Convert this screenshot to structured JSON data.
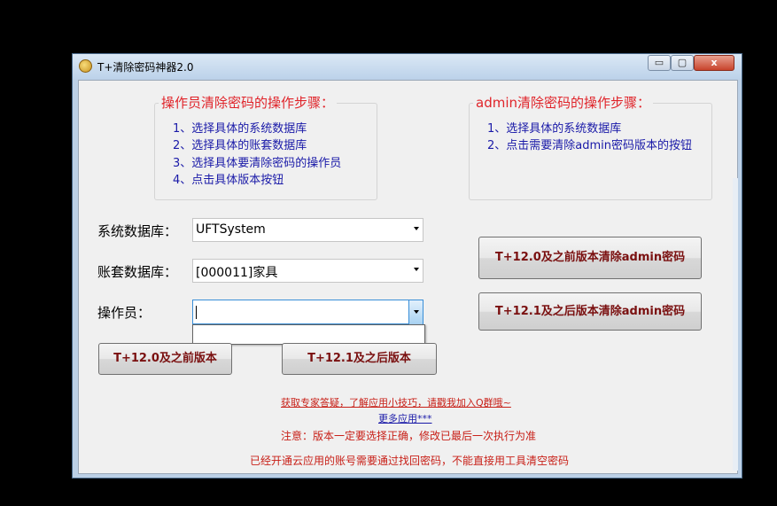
{
  "window": {
    "title": "T+清除密码神器2.0",
    "controls": {
      "minimize": "▭",
      "maximize": "▢",
      "close": "x"
    }
  },
  "operator_steps": {
    "title": "操作员清除密码的操作步骤：",
    "items": [
      "1、选择具体的系统数据库",
      "2、选择具体的账套数据库",
      "3、选择具体要清除密码的操作员",
      "4、点击具体版本按钮"
    ]
  },
  "admin_steps": {
    "title": "admin清除密码的操作步骤：",
    "items": [
      "1、选择具体的系统数据库",
      "2、点击需要清除admin密码版本的按钮"
    ]
  },
  "form": {
    "system_db_label": "系统数据库：",
    "system_db_value": "UFTSystem",
    "account_db_label": "账套数据库：",
    "account_db_value": "[000011]家具",
    "operator_label": "操作员：",
    "operator_value": ""
  },
  "buttons": {
    "v120_before": "T+12.0及之前版本",
    "v121_after": "T+12.1及之后版本",
    "admin_v120_before": "T+12.0及之前版本清除admin密码",
    "admin_v121_after": "T+12.1及之后版本清除admin密码"
  },
  "footer": {
    "expert_link": "获取专家答疑，了解应用小技巧，请戳我加入Q群哦~",
    "more_apps_link": "更多应用***",
    "note1": "注意：版本一定要选择正确，修改已最后一次执行为准",
    "note2": "已经开通云应用的账号需要通过找回密码，不能直接用工具清空密码"
  },
  "colors": {
    "step_title_red": "#e0242a",
    "step_text_blue": "#1a1aa8",
    "button_text": "#7a1010",
    "link_red": "#c82018",
    "link_blue": "#1a1aa8"
  }
}
